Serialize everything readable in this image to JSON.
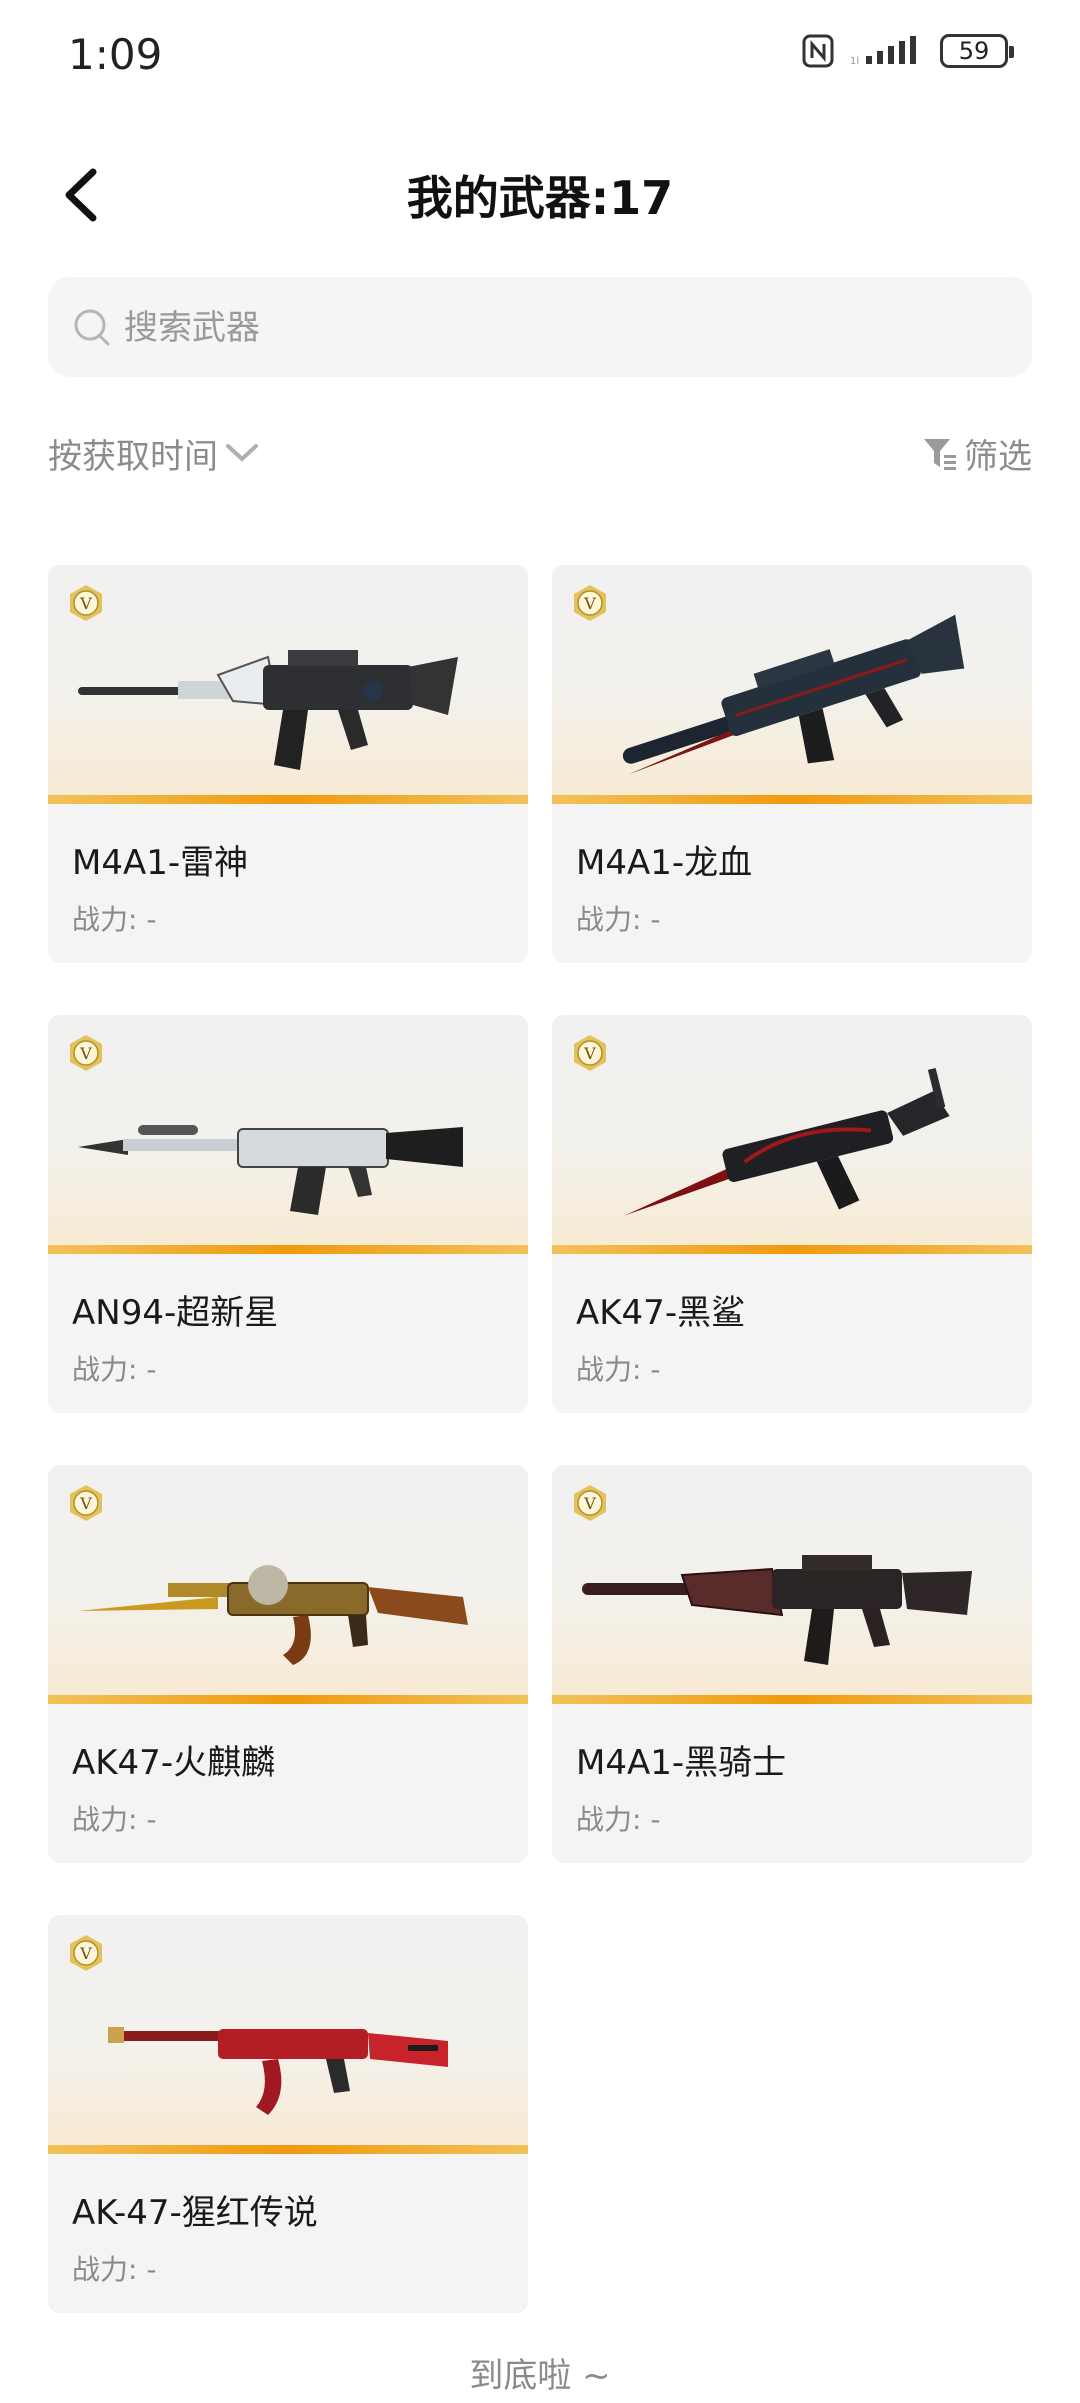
{
  "status_bar": {
    "time": "1:09",
    "battery": "59"
  },
  "header": {
    "title": "我的武器:17"
  },
  "search": {
    "placeholder": "搜索武器"
  },
  "toolbar": {
    "sort_label": "按获取时间",
    "filter_label": "筛选"
  },
  "weapons": [
    {
      "name": "M4A1-雷神",
      "power": "战力: -",
      "badge": "V"
    },
    {
      "name": "M4A1-龙血",
      "power": "战力: -",
      "badge": "V"
    },
    {
      "name": "AN94-超新星",
      "power": "战力: -",
      "badge": "V"
    },
    {
      "name": "AK47-黑鲨",
      "power": "战力: -",
      "badge": "V"
    },
    {
      "name": "AK47-火麒麟",
      "power": "战力: -",
      "badge": "V"
    },
    {
      "name": "M4A1-黑骑士",
      "power": "战力: -",
      "badge": "V"
    },
    {
      "name": "AK-47-猩红传说",
      "power": "战力: -",
      "badge": "V"
    }
  ],
  "footer": {
    "text": "到底啦 ~"
  },
  "colors": {
    "accent_bar": "#f09a0d",
    "card_bg": "#f4f4f4",
    "badge_gold": "#e3c25c"
  }
}
